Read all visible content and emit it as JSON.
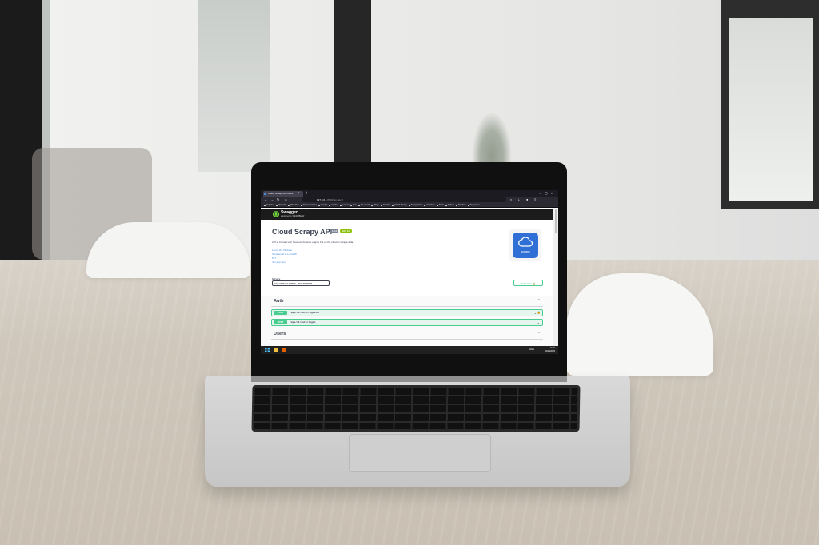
{
  "browser": {
    "tab_title": "Cloud Scrapy API Docs",
    "new_tab": "+",
    "tab_close": "×",
    "window_controls": "–▢×",
    "url_host": "127.0.0.1",
    "url_path": ":8000/api-docs/",
    "bookmarks": [
      "Imported",
      "Tutorials",
      "Web Dev",
      "Documentation",
      "Design",
      "Articles",
      "Laravel",
      "Dev",
      "Dev Tools",
      "Blogs",
      "Youtube",
      "Cloud Scrapy",
      "Scrapy Docs",
      "Crawlers",
      "Tools",
      "Python",
      "Readers",
      "Puppeteer"
    ]
  },
  "swagger": {
    "brand": "Swagger",
    "brand_sub": "supported by SMARTBEAR",
    "logo_glyph": "{}"
  },
  "info": {
    "title": "Cloud Scrapy API",
    "version_badge": "1.0.0",
    "oas_badge": "OAS 3.0",
    "description": "API to interact with headless browser engine bot on the cloud to scrape data.",
    "links": [
      "Lucca W - Website",
      "Send email to Lucca W",
      "MIT",
      "/api-json.json"
    ],
    "app_logo_text": "scrapy"
  },
  "servers": {
    "label": "Servers",
    "selected": "http://127.0.0.1:8000 - DEV SERVER",
    "caret": "⌄",
    "authorize_label": "Authorize",
    "lock_icon": "🔒"
  },
  "sections": [
    {
      "name": "Auth",
      "chevron": "⌃",
      "operations": [
        {
          "method": "POST",
          "path": "/api/v1/auth/register",
          "chevron": "⌄",
          "lock": "🔒"
        },
        {
          "method": "POST",
          "path": "/api/v1/auth/login",
          "chevron": "⌄"
        }
      ]
    },
    {
      "name": "Users",
      "chevron": "⌃"
    }
  ],
  "taskbar": {
    "lang": "ENG",
    "time": "14:31",
    "date": "02/26/2023"
  },
  "colors": {
    "accent_post": "#49cc90",
    "title": "#3b4151",
    "link": "#4990e2",
    "app_logo": "#2f6fd6",
    "browser_dark": "#1c1b22"
  }
}
